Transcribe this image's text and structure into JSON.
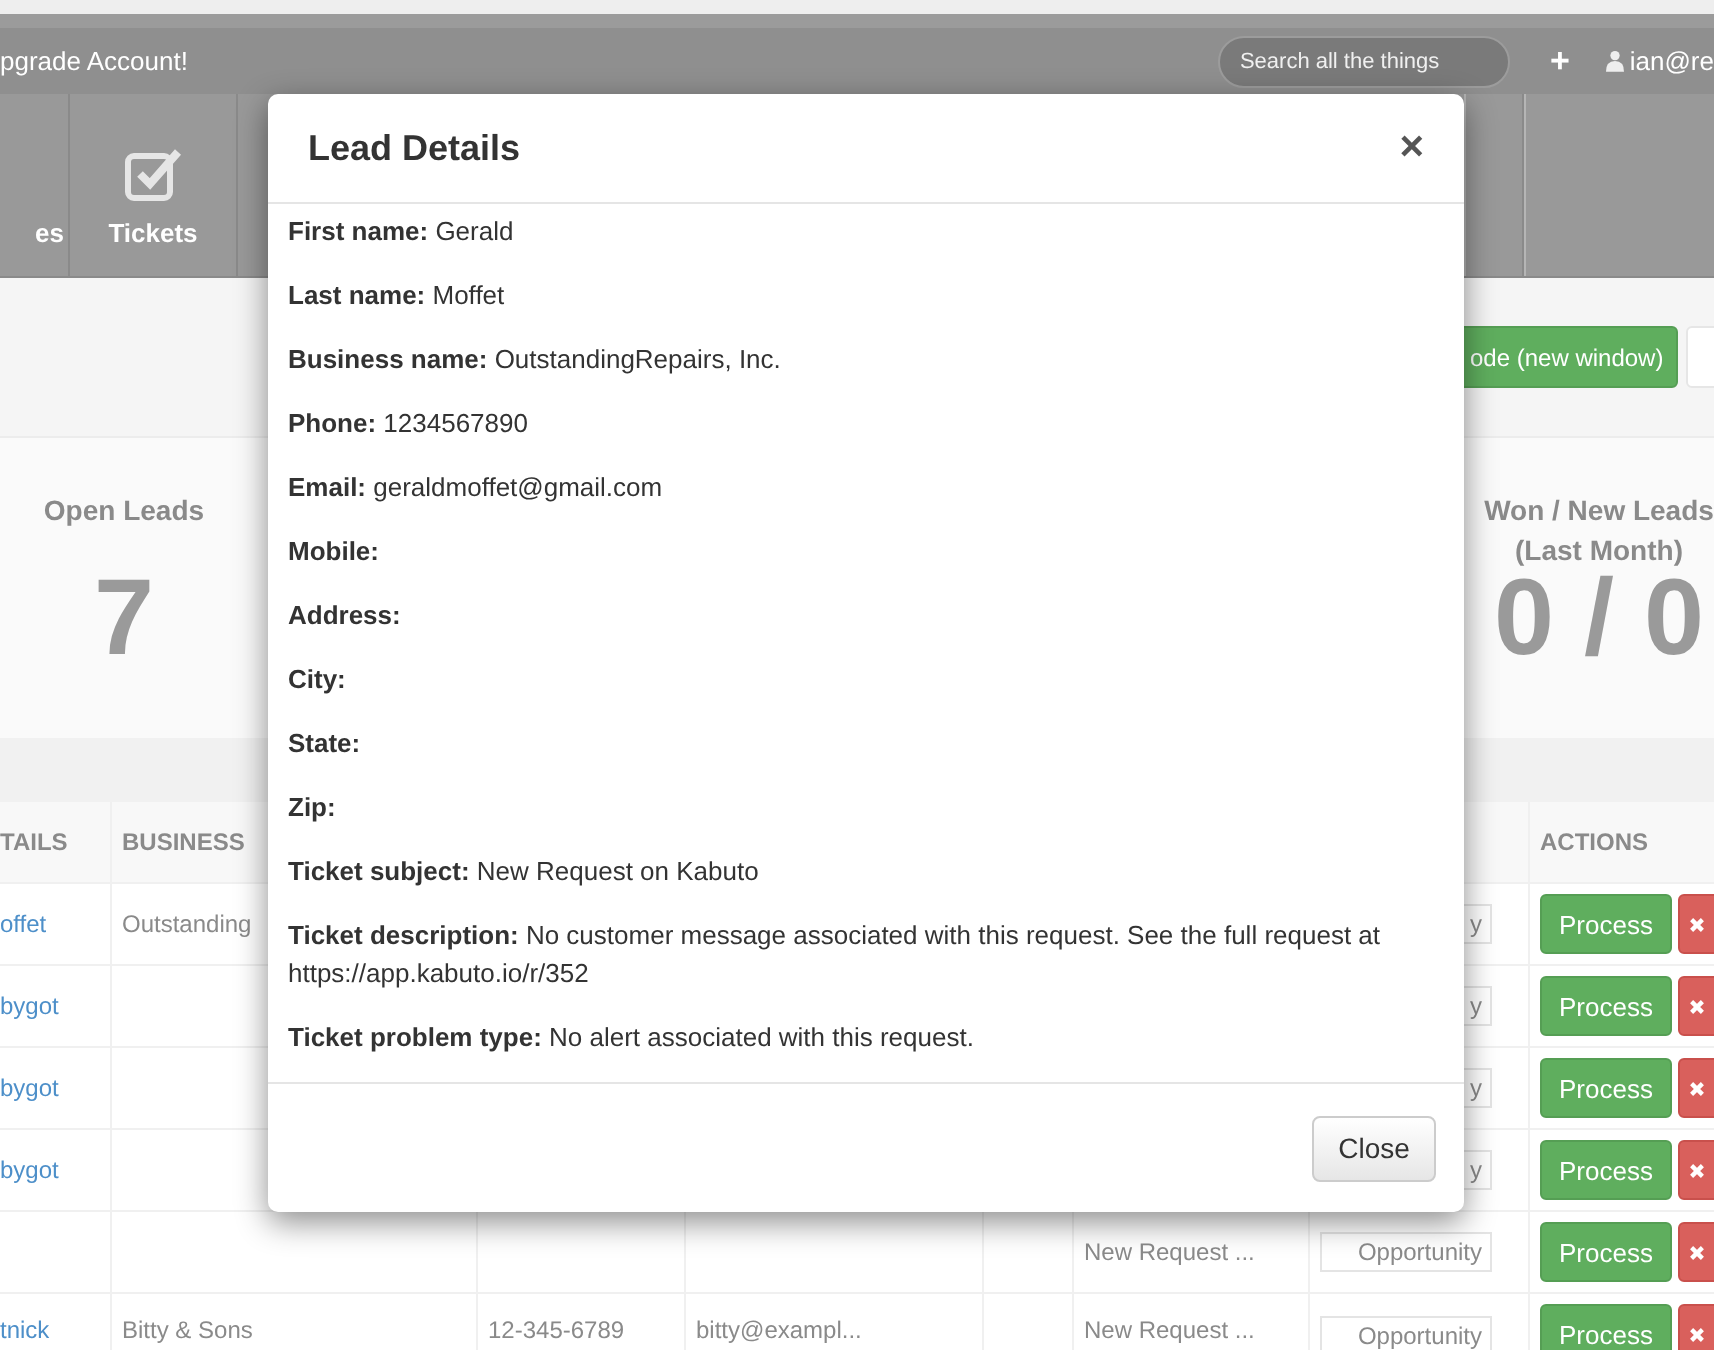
{
  "navbar": {
    "upgrade_link": "pgrade Account!",
    "search": {
      "placeholder": "Search all the things"
    },
    "add": "+",
    "user": "ian@re"
  },
  "nav_tiles": [
    {
      "label": "es",
      "kind": "cut"
    },
    {
      "label": "Tickets",
      "kind": "tickets"
    }
  ],
  "toolbar_buttons": [
    {
      "label": "ode (new window)",
      "kind": "success"
    },
    {
      "kind": "default"
    }
  ],
  "stats": [
    {
      "title": "Open Leads",
      "value": "7"
    },
    {
      "title": "Won / New Leads (Last Month)",
      "value": "0 / 0"
    }
  ],
  "table": {
    "columns": {
      "details": "TAILS",
      "business_name": "BUSINESS",
      "actions": "ACTIONS"
    },
    "rows": [
      {
        "details": "offet",
        "business_name": "Outstanding",
        "column_7": "y",
        "action": "Process"
      },
      {
        "details": "bygot",
        "column_7": "y",
        "action": "Process"
      },
      {
        "details": "bygot",
        "column_7": "y",
        "action": "Process"
      },
      {
        "details": "bygot",
        "column_7": "y",
        "action": "Process"
      },
      {
        "column_6": "New Request ...",
        "column_7": "Opportunity",
        "action": "Process"
      },
      {
        "details": "tnick",
        "business_name": "Bitty & Sons",
        "column_3": "12-345-6789",
        "column_4": "bitty@exampl...",
        "column_6": "New Request ...",
        "column_7": "Opportunity",
        "action": "Process"
      }
    ]
  },
  "modal": {
    "title": "Lead Details",
    "close_icon": "×",
    "fields": [
      {
        "label": "First name:",
        "value": "Gerald"
      },
      {
        "label": "Last name:",
        "value": "Moffet"
      },
      {
        "label": "Business name:",
        "value": "OutstandingRepairs, Inc."
      },
      {
        "label": "Phone:",
        "value": "1234567890"
      },
      {
        "label": "Email:",
        "value": "geraldmoffet@gmail.com"
      },
      {
        "label": "Mobile:"
      },
      {
        "label": "Address:"
      },
      {
        "label": "City:"
      },
      {
        "label": "State:"
      },
      {
        "label": "Zip:"
      },
      {
        "label": "Ticket subject:",
        "value": "New Request on Kabuto"
      },
      {
        "label": "Ticket description:",
        "value": "No customer message associated with this request. See the full request at https://app.kabuto.io/r/352"
      },
      {
        "label": "Ticket problem type:",
        "value": "No alert associated with this request."
      }
    ],
    "footer_button": "Close"
  }
}
